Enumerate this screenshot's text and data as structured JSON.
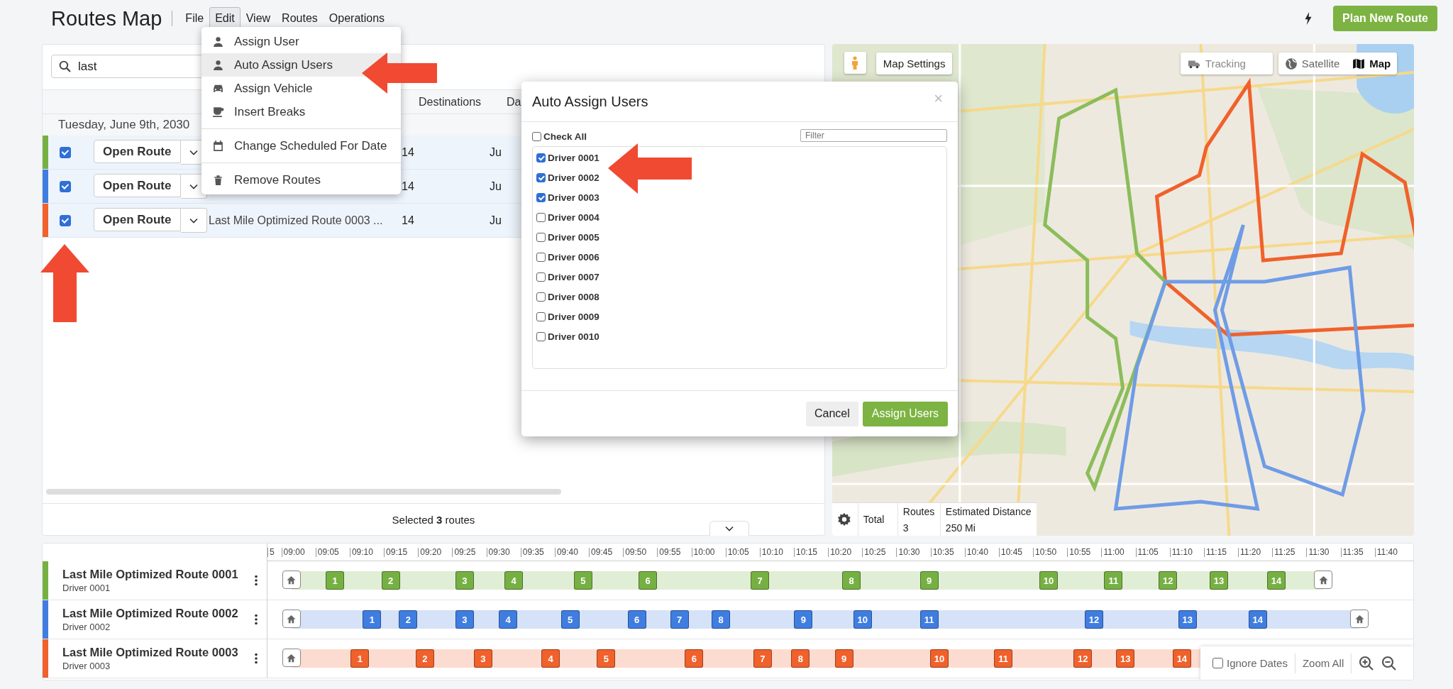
{
  "header": {
    "title": "Routes Map",
    "menu": [
      {
        "label": "File",
        "selected": false
      },
      {
        "label": "Edit",
        "selected": true
      },
      {
        "label": "View",
        "selected": false
      },
      {
        "label": "Routes",
        "selected": false
      },
      {
        "label": "Operations",
        "selected": false
      }
    ],
    "plan_button": "Plan New Route"
  },
  "routes_panel": {
    "search": {
      "value": "last"
    },
    "columns": [
      "Destinations",
      "Da"
    ],
    "group": "Tuesday, June 9th, 2030",
    "rows": [
      {
        "color": "#76b043",
        "checked": true,
        "open_label": "Open Route",
        "destinations": "14",
        "date": "Ju"
      },
      {
        "color": "#3f7de0",
        "checked": true,
        "open_label": "Open Route",
        "destinations": "14",
        "date": "Ju"
      },
      {
        "color": "#f0612b",
        "checked": true,
        "open_label": "Open Route",
        "name": "Last Mile Optimized Route 0003 ...",
        "destinations": "14",
        "date": "Ju"
      }
    ],
    "footer": "Selected **3** routes"
  },
  "edit_menu": {
    "groups": [
      [
        {
          "label": "Assign User",
          "selected": false
        },
        {
          "label": "Auto Assign Users",
          "selected": true
        },
        {
          "label": "Assign Vehicle",
          "selected": false
        },
        {
          "label": "Insert Breaks",
          "selected": false
        }
      ],
      [
        {
          "label": "Change Scheduled For Date",
          "selected": false
        }
      ],
      [
        {
          "label": "Remove Routes",
          "selected": false
        }
      ]
    ]
  },
  "map": {
    "settings_button": "Map Settings",
    "tracking": {
      "label": "Tracking",
      "disabled": true
    },
    "map_types": [
      {
        "label": "Satellite",
        "selected": false
      },
      {
        "label": "Map",
        "selected": true
      }
    ],
    "totals": {
      "label": "Total",
      "columns": [
        "Routes",
        "Estimated Distance"
      ],
      "values": [
        "3",
        "250 Mi"
      ]
    }
  },
  "modal": {
    "title": "Auto Assign Users",
    "close": "×",
    "check_all": {
      "label": "Check All",
      "checked": false
    },
    "filter": {
      "placeholder": "Filter"
    },
    "drivers": [
      {
        "label": "Driver 0001",
        "checked": true
      },
      {
        "label": "Driver 0002",
        "checked": true
      },
      {
        "label": "Driver 0003",
        "checked": true
      },
      {
        "label": "Driver 0004",
        "checked": false
      },
      {
        "label": "Driver 0005",
        "checked": false
      },
      {
        "label": "Driver 0006",
        "checked": false
      },
      {
        "label": "Driver 0007",
        "checked": false
      },
      {
        "label": "Driver 0008",
        "checked": false
      },
      {
        "label": "Driver 0009",
        "checked": false
      },
      {
        "label": "Driver 0010",
        "checked": false
      }
    ],
    "cancel": "Cancel",
    "confirm": "Assign Users"
  },
  "timeline": {
    "ticks": [
      "5",
      "09:00",
      "09:05",
      "09:10",
      "09:15",
      "09:20",
      "09:25",
      "09:30",
      "09:35",
      "09:40",
      "09:45",
      "09:50",
      "09:55",
      "10:00",
      "10:05",
      "10:10",
      "10:15",
      "10:20",
      "10:25",
      "10:30",
      "10:35",
      "10:40",
      "10:45",
      "10:50",
      "10:55",
      "11:00",
      "11:05",
      "11:10",
      "11:15",
      "11:20",
      "11:25",
      "11:30",
      "11:35",
      "11:40"
    ],
    "routes": [
      {
        "name": "Last Mile Optimized Route 0001",
        "driver": "Driver 0001",
        "color": "#76b043",
        "stops": [
          {
            "kind": "home"
          },
          {
            "kind": "stop",
            "label": "1"
          },
          {
            "kind": "stop",
            "label": "2"
          },
          {
            "kind": "stop",
            "label": "3"
          },
          {
            "kind": "stop",
            "label": "4"
          },
          {
            "kind": "stop",
            "label": "5"
          },
          {
            "kind": "stop",
            "label": "6"
          },
          {
            "kind": "stop",
            "label": "7"
          },
          {
            "kind": "stop",
            "label": "8"
          },
          {
            "kind": "stop",
            "label": "9"
          },
          {
            "kind": "stop",
            "label": "10"
          },
          {
            "kind": "stop",
            "label": "11"
          },
          {
            "kind": "stop",
            "label": "12"
          },
          {
            "kind": "stop",
            "label": "13"
          },
          {
            "kind": "stop",
            "label": "14"
          },
          {
            "kind": "home"
          }
        ]
      },
      {
        "name": "Last Mile Optimized Route 0002",
        "driver": "Driver 0002",
        "color": "#3f7de0",
        "stops": [
          {
            "kind": "home"
          },
          {
            "kind": "stop",
            "label": "1"
          },
          {
            "kind": "stop",
            "label": "2"
          },
          {
            "kind": "stop",
            "label": "3"
          },
          {
            "kind": "stop",
            "label": "4"
          },
          {
            "kind": "stop",
            "label": "5"
          },
          {
            "kind": "stop",
            "label": "6"
          },
          {
            "kind": "stop",
            "label": "7"
          },
          {
            "kind": "stop",
            "label": "8"
          },
          {
            "kind": "stop",
            "label": "9"
          },
          {
            "kind": "stop",
            "label": "10"
          },
          {
            "kind": "stop",
            "label": "11"
          },
          {
            "kind": "stop",
            "label": "12"
          },
          {
            "kind": "stop",
            "label": "13"
          },
          {
            "kind": "stop",
            "label": "14"
          },
          {
            "kind": "home"
          }
        ]
      },
      {
        "name": "Last Mile Optimized Route 0003",
        "driver": "Driver 0003",
        "color": "#f0612b",
        "stops": [
          {
            "kind": "home"
          },
          {
            "kind": "stop",
            "label": "1"
          },
          {
            "kind": "stop",
            "label": "2"
          },
          {
            "kind": "stop",
            "label": "3"
          },
          {
            "kind": "stop",
            "label": "4"
          },
          {
            "kind": "stop",
            "label": "5"
          },
          {
            "kind": "stop",
            "label": "6"
          },
          {
            "kind": "stop",
            "label": "7"
          },
          {
            "kind": "stop",
            "label": "8"
          },
          {
            "kind": "stop",
            "label": "9"
          },
          {
            "kind": "stop",
            "label": "10"
          },
          {
            "kind": "stop",
            "label": "11"
          },
          {
            "kind": "stop",
            "label": "12"
          },
          {
            "kind": "stop",
            "label": "13"
          },
          {
            "kind": "stop",
            "label": "14"
          }
        ]
      }
    ],
    "controls": {
      "ignore_dates": {
        "label": "Ignore Dates",
        "checked": false
      },
      "zoom_all": "Zoom All"
    }
  }
}
